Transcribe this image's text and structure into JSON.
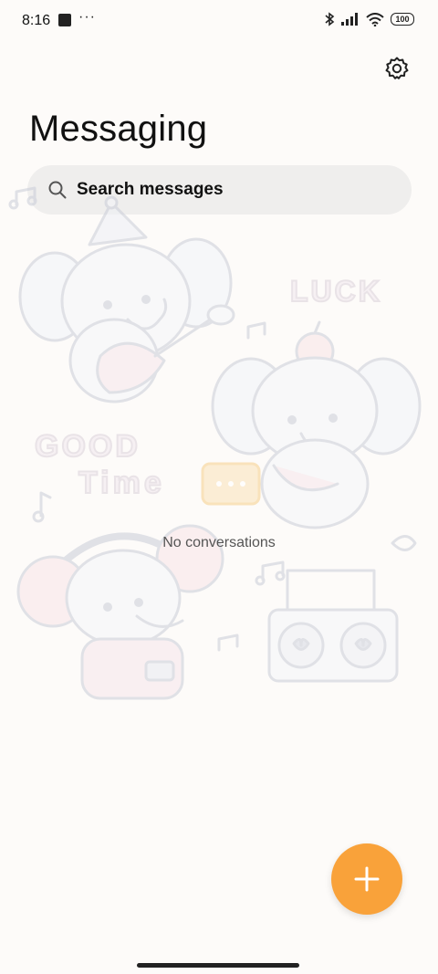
{
  "status_bar": {
    "time": "8:16",
    "more": "···",
    "battery": "100",
    "icons": [
      "bluetooth-icon",
      "signal-icon",
      "wifi-icon",
      "battery-icon"
    ]
  },
  "header": {
    "title": "Messaging",
    "settings_icon": "gear-icon"
  },
  "search": {
    "placeholder": "Search messages",
    "icon": "search-icon"
  },
  "illustration": {
    "luck": "LUCK",
    "good": "GOOD",
    "time": "Time"
  },
  "empty_state": {
    "text": "No conversations"
  },
  "fab": {
    "icon": "plus-icon",
    "color": "#f9a23a"
  }
}
